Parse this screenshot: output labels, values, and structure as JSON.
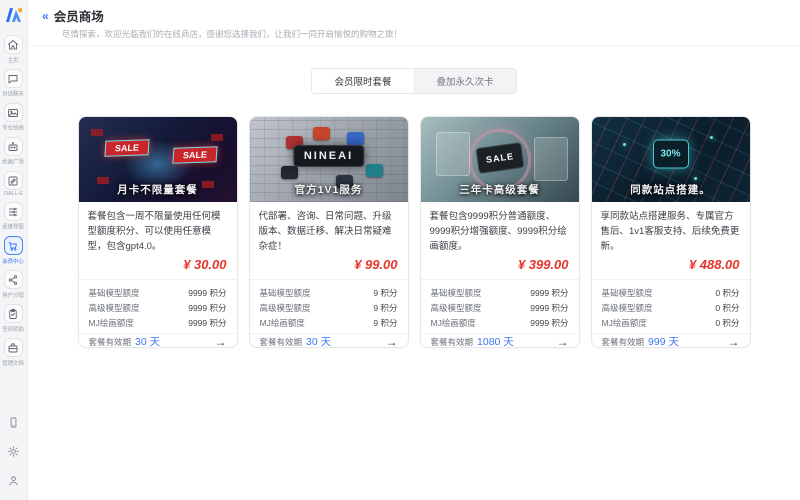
{
  "brand": {
    "logo_name": "nineai-logo"
  },
  "header": {
    "collapse_icon": "«",
    "title": "会员商场",
    "subtitle": "尽情探索，欢迎光临我们的在线商店，感谢您选择我们，让我们一同开启愉悦的购物之旅！"
  },
  "sidebar": {
    "items": [
      {
        "label": "主页",
        "icon": "home-icon",
        "active": false
      },
      {
        "label": "对话聊天",
        "icon": "chat-icon",
        "active": false
      },
      {
        "label": "专业绘画",
        "icon": "image-icon",
        "active": false
      },
      {
        "label": "绘画广场",
        "icon": "robot-icon",
        "active": false
      },
      {
        "label": "DALL-E",
        "icon": "edit-icon",
        "active": false
      },
      {
        "label": "思维导图",
        "icon": "mindmap-icon",
        "active": false
      },
      {
        "label": "会员中心",
        "icon": "cart-icon",
        "active": true
      },
      {
        "label": "用户分销",
        "icon": "share-icon",
        "active": false
      },
      {
        "label": "签到奖励",
        "icon": "clipboard-icon",
        "active": false
      },
      {
        "label": "管理文档",
        "icon": "bag-icon",
        "active": false
      }
    ],
    "footer_icons": [
      {
        "name": "mobile-icon"
      },
      {
        "name": "theme-sun-icon"
      },
      {
        "name": "user-icon"
      }
    ]
  },
  "tabs": [
    {
      "label": "会员限时套餐",
      "active": true
    },
    {
      "label": "叠加永久次卡",
      "active": false
    }
  ],
  "cards": [
    {
      "image": {
        "variant": "v-darkred",
        "overlay_title": "月卡不限量套餐",
        "labels": [
          "SALE",
          "SALE"
        ]
      },
      "description": "套餐包含一周不限量使用任何模型额度积分、可以使用任意模型，包含gpt4.0。",
      "price": "¥ 30.00",
      "rows": [
        {
          "label": "基础模型额度",
          "value": "9999 积分"
        },
        {
          "label": "高级模型额度",
          "value": "9999 积分"
        },
        {
          "label": "MJ绘画额度",
          "value": "9999 积分"
        }
      ],
      "validity_label": "套餐有效期",
      "validity_value": "30 天",
      "arrow": "→"
    },
    {
      "image": {
        "variant": "v-circuit",
        "overlay_title": "官方1V1服务",
        "labels": [
          "NINEAI"
        ]
      },
      "description": "代部署、咨询、日常问题、升级版本、数据迁移、解决日常疑难杂症！",
      "price": "¥ 99.00",
      "rows": [
        {
          "label": "基础模型额度",
          "value": "9 积分"
        },
        {
          "label": "高级模型额度",
          "value": "9 积分"
        },
        {
          "label": "MJ绘画额度",
          "value": "9 积分"
        }
      ],
      "validity_label": "套餐有效期",
      "validity_value": "30 天",
      "arrow": "→"
    },
    {
      "image": {
        "variant": "v-teal",
        "overlay_title": "三年卡高级套餐",
        "labels": [
          "SALE"
        ]
      },
      "description": "套餐包含9999积分普通额度、9999积分增强额度、9999积分绘画额度。",
      "price": "¥ 399.00",
      "rows": [
        {
          "label": "基础模型额度",
          "value": "9999 积分"
        },
        {
          "label": "高级模型额度",
          "value": "9999 积分"
        },
        {
          "label": "MJ绘画额度",
          "value": "9999 积分"
        }
      ],
      "validity_label": "套餐有效期",
      "validity_value": "1080 天",
      "arrow": "→"
    },
    {
      "image": {
        "variant": "v-darkteal",
        "overlay_title": "同款站点搭建。",
        "labels": [
          "30%"
        ]
      },
      "description": "享同款站点搭建服务、专属官方售后、1v1客服支持、后续免费更新。",
      "price": "¥ 488.00",
      "rows": [
        {
          "label": "基础模型额度",
          "value": "0 积分"
        },
        {
          "label": "高级模型额度",
          "value": "0 积分"
        },
        {
          "label": "MJ绘画额度",
          "value": "0 积分"
        }
      ],
      "validity_label": "套餐有效期",
      "validity_value": "999 天",
      "arrow": "→"
    }
  ],
  "colors": {
    "accent_blue": "#3d78f2",
    "price_red": "#e5332a",
    "sidebar_bg": "#f4f5f7"
  }
}
